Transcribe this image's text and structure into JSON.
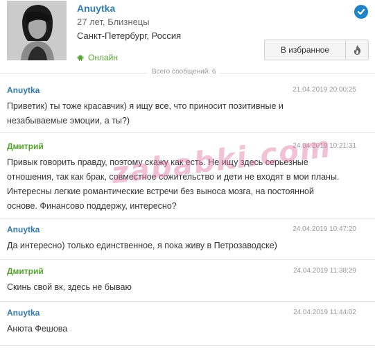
{
  "profile": {
    "name": "Anuytka",
    "age_sign": "27 лет, Близнецы",
    "location": "Санкт-Петербург, Россия",
    "status": "Онлайн",
    "favorite_label": "В избранное",
    "verified_icon": "check-circle-icon",
    "accent_color": "#2f7eb2",
    "online_color": "#59a633"
  },
  "total_messages": "Всего сообщений: 6",
  "messages": [
    {
      "author": "Anuytka",
      "time": "21.04.2019 20:00:25",
      "lines": [
        "Приветик) ты тоже красавчик) я ищу все, что приносит позитивные и",
        "незабываемые эмоции, а ты?)"
      ]
    },
    {
      "author": "Дмитрий",
      "time": "24.04.2019 10:21:31",
      "lines": [
        "Привык говорить правду, поэтому скажу как есть. Не ищу здесь серьезные",
        "отношения, так как брак, совместное сожительство и дети не входят в мои планы.",
        "Интересны легкие романтические встречи без выноса мозга, на постоянной",
        "основе. Финансово поддержу, интересно?"
      ]
    },
    {
      "author": "Anuytka",
      "time": "24.04.2019 10:47:20",
      "lines": [
        "Да интересно) только единственное, я пока живу в Петрозаводске)"
      ]
    },
    {
      "author": "Дмитрий",
      "time": "24.04.2019 11:38:29",
      "lines": [
        "Скинь свой вк, здесь не бываю"
      ]
    },
    {
      "author": "Anuytka",
      "time": "24.04.2019 11:44:02",
      "lines": [
        "Анюта Фешова"
      ]
    }
  ],
  "watermark": "zababki.com"
}
